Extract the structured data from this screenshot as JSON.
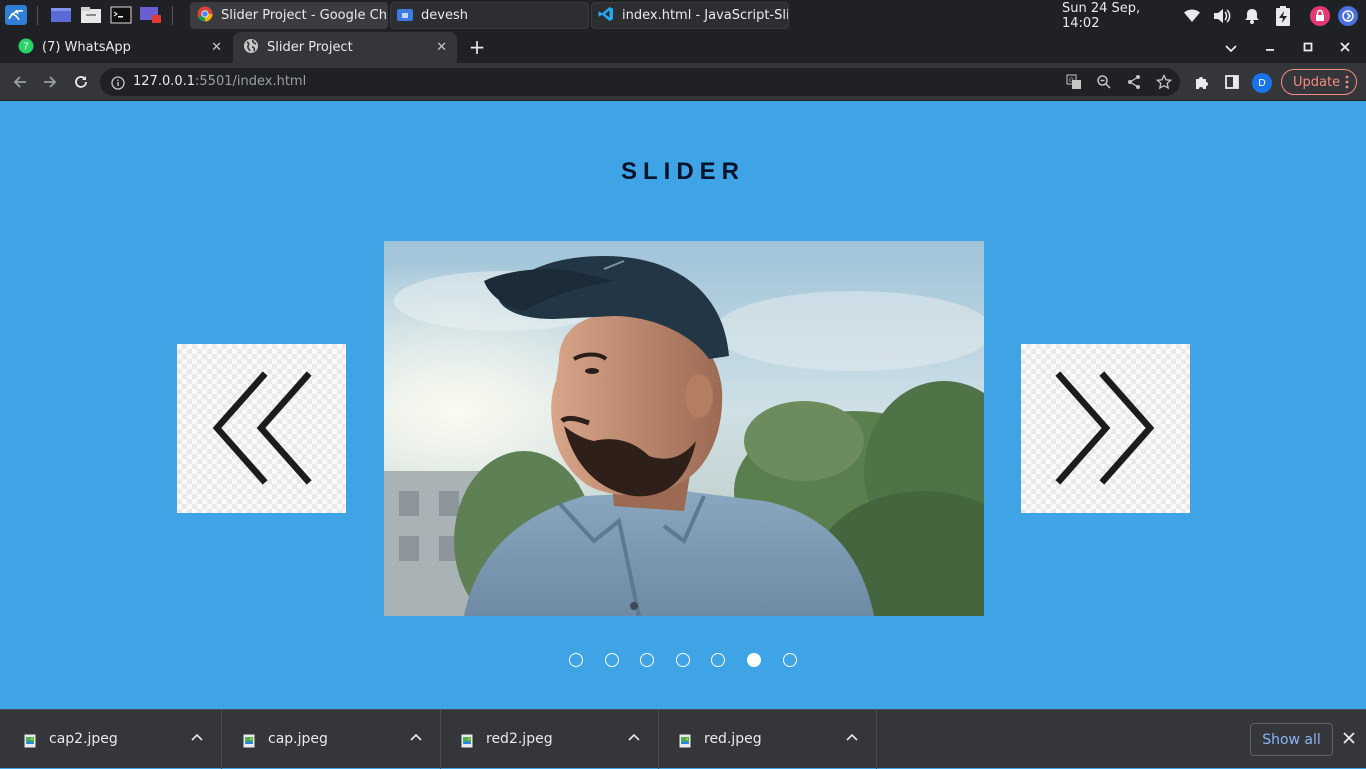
{
  "taskbar": {
    "apps": [
      "kali-menu-icon",
      "workspace-icon",
      "file-manager-icon",
      "terminal-icon",
      "screen-recorder-icon"
    ],
    "windows": [
      {
        "label": "Slider Project - Google Ch...",
        "icon": "chrome-icon"
      },
      {
        "label": "devesh",
        "icon": "folder-icon"
      },
      {
        "label": "index.html - JavaScript-Sli...",
        "icon": "vscode-icon"
      }
    ],
    "clock": "Sun 24 Sep, 14:02"
  },
  "browser": {
    "tabs": [
      {
        "label": "(7) WhatsApp",
        "icon": "whatsapp-icon",
        "active": false
      },
      {
        "label": "Slider Project",
        "icon": "globe-icon",
        "active": true
      }
    ],
    "url_host": "127.0.0.1",
    "url_path": ":5501/index.html",
    "profile_initial": "D",
    "update_label": "Update"
  },
  "page": {
    "title": "SLIDER",
    "prev_label": "previous slide",
    "next_label": "next slide",
    "dots_total": 7,
    "active_dot": 6,
    "background": "#3ea4e6"
  },
  "downloads": {
    "items": [
      "cap2.jpeg",
      "cap.jpeg",
      "red2.jpeg",
      "red.jpeg"
    ],
    "show_all": "Show all"
  }
}
